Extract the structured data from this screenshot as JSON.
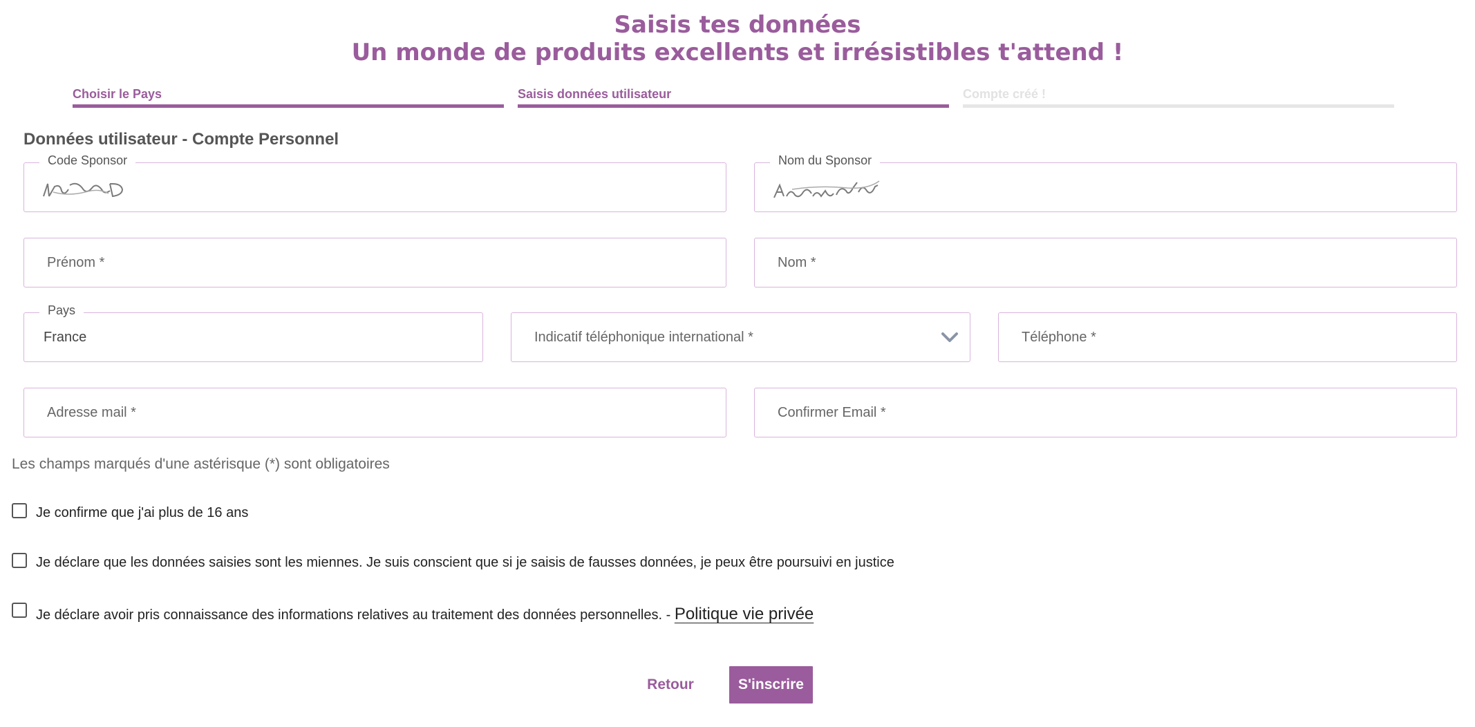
{
  "header": {
    "title_line1": "Saisis tes données",
    "title_line2": "Un monde de produits excellents et irrésistibles t'attend !"
  },
  "steps": [
    {
      "label": "Choisir le Pays",
      "state": "done"
    },
    {
      "label": "Saisis données utilisateur",
      "state": "current"
    },
    {
      "label": "Compte créé !",
      "state": "upcoming"
    }
  ],
  "form": {
    "section_title": "Données utilisateur - Compte Personnel",
    "sponsor_code": {
      "label": "Code Sponsor",
      "value_type": "captcha-image"
    },
    "sponsor_name": {
      "label": "Nom du Sponsor",
      "value_type": "captcha-image"
    },
    "first_name": {
      "placeholder": "Prénom *"
    },
    "last_name": {
      "placeholder": "Nom *"
    },
    "country": {
      "label": "Pays",
      "value": "France"
    },
    "dial_code": {
      "placeholder": "Indicatif téléphonique international *",
      "icon": "chevron-down-icon"
    },
    "phone": {
      "placeholder": "Téléphone *"
    },
    "email": {
      "placeholder": "Adresse mail *"
    },
    "email_confirm": {
      "placeholder": "Confirmer Email *"
    },
    "required_note": "Les champs marqués d'une astérisque (*) sont obligatoires",
    "checkboxes": [
      {
        "label": "Je confirme que j'ai plus de 16 ans",
        "checked": false
      },
      {
        "label": "Je déclare que les données saisies sont les miennes. Je suis conscient que si je saisis de fausses données, je peux être poursuivi en justice",
        "checked": false
      },
      {
        "label": "Je déclare avoir pris connaissance des informations relatives au traitement des données personnelles. - ",
        "link": "Politique vie privée",
        "checked": false
      }
    ]
  },
  "actions": {
    "back_label": "Retour",
    "submit_label": "S'inscrire"
  },
  "colors": {
    "accent": "#9a5c9c",
    "field_border": "#d9b3dc",
    "inactive_step": "#e6e6e6"
  }
}
